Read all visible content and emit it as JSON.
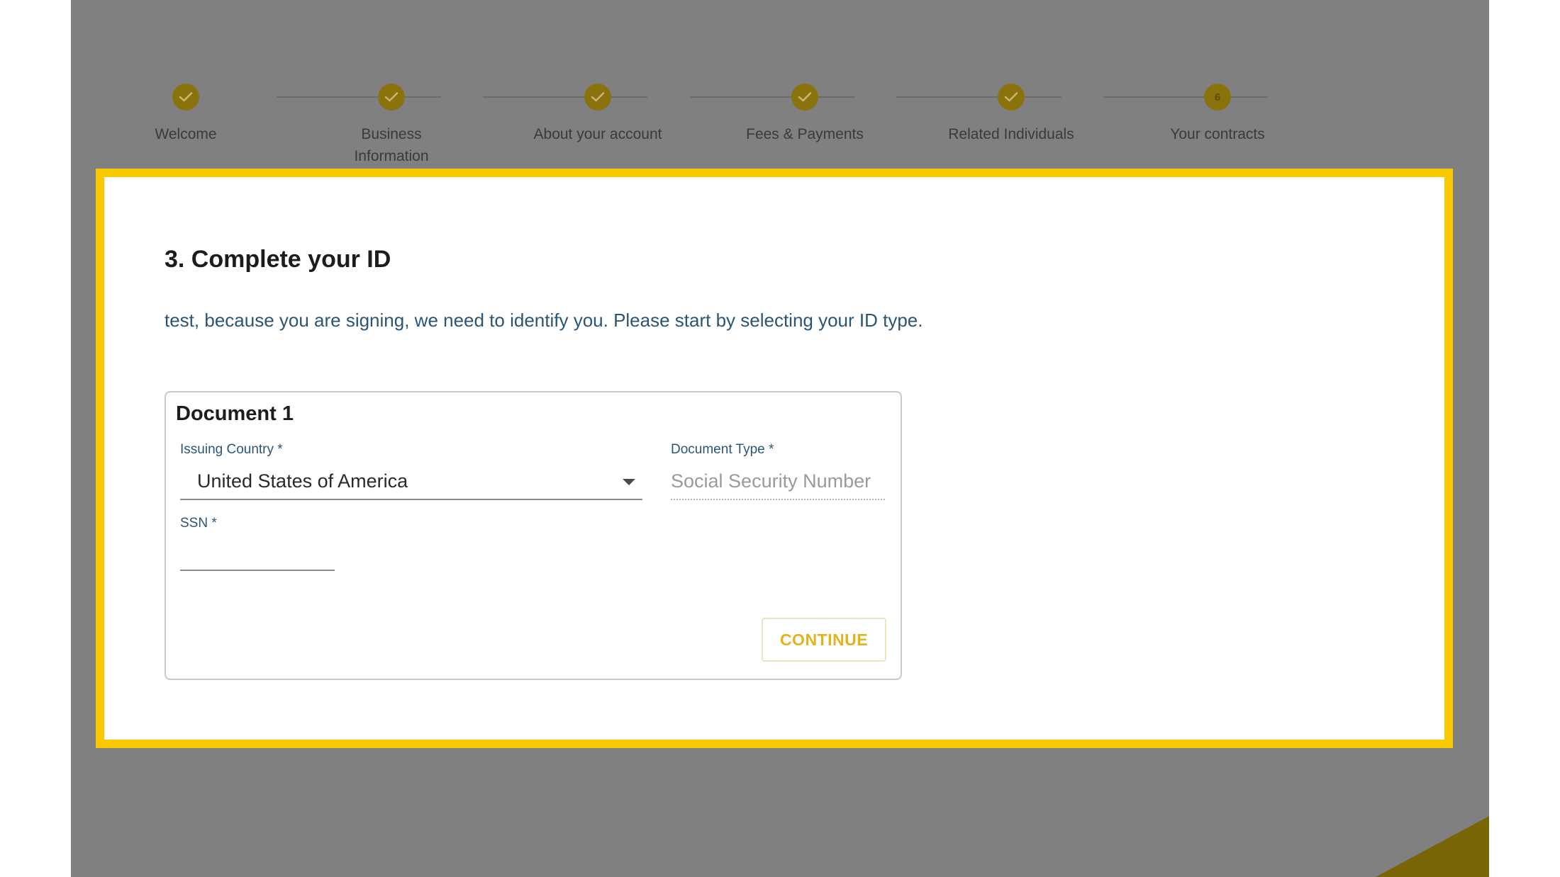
{
  "stepper": {
    "steps": [
      {
        "label": "Welcome",
        "state": "complete"
      },
      {
        "label": "Business Information",
        "state": "complete"
      },
      {
        "label": "About your account",
        "state": "complete"
      },
      {
        "label": "Fees & Payments",
        "state": "complete"
      },
      {
        "label": "Related Individuals",
        "state": "complete"
      },
      {
        "label": "Your contracts",
        "state": "current",
        "number": "6"
      }
    ]
  },
  "modal": {
    "title": "3. Complete your ID",
    "subtitle": "test, because you are signing, we need to identify you. Please start by selecting your ID type."
  },
  "document": {
    "title": "Document 1",
    "issuing_country_label": "Issuing Country *",
    "issuing_country_value": "United States of America",
    "document_type_label": "Document Type *",
    "document_type_value": "Social Security Number",
    "ssn_label": "SSN *",
    "ssn_value": "",
    "continue_label": "CONTINUE"
  },
  "colors": {
    "highlight_border": "#f9c900",
    "accent_gold": "#e2b41a",
    "overlay_gray": "#808080",
    "label_blue": "#2b5576"
  }
}
